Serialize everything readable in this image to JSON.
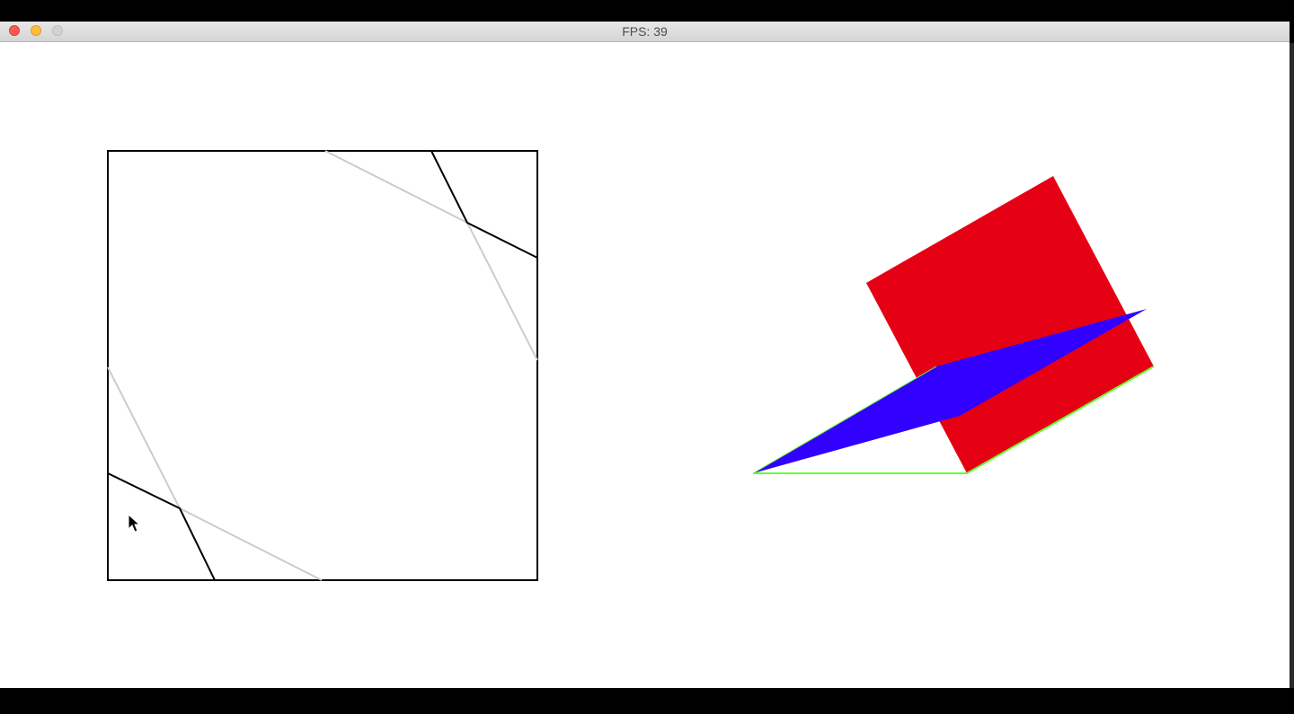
{
  "window": {
    "title": "FPS: 39",
    "traffic_lights": {
      "close": "#fc5753",
      "minimize": "#fdbc40",
      "zoom": "#d2d2d2"
    }
  },
  "scene": {
    "left_view": {
      "frame_color": "#000000",
      "fold_line_color": "#000000",
      "guide_line_color": "#cccccc"
    },
    "right_view": {
      "face_front_color": "#e60014",
      "face_diagonal_color": "#3200ff",
      "edge_color": "#66ff33"
    },
    "cursor": "mouse-cursor-icon"
  }
}
